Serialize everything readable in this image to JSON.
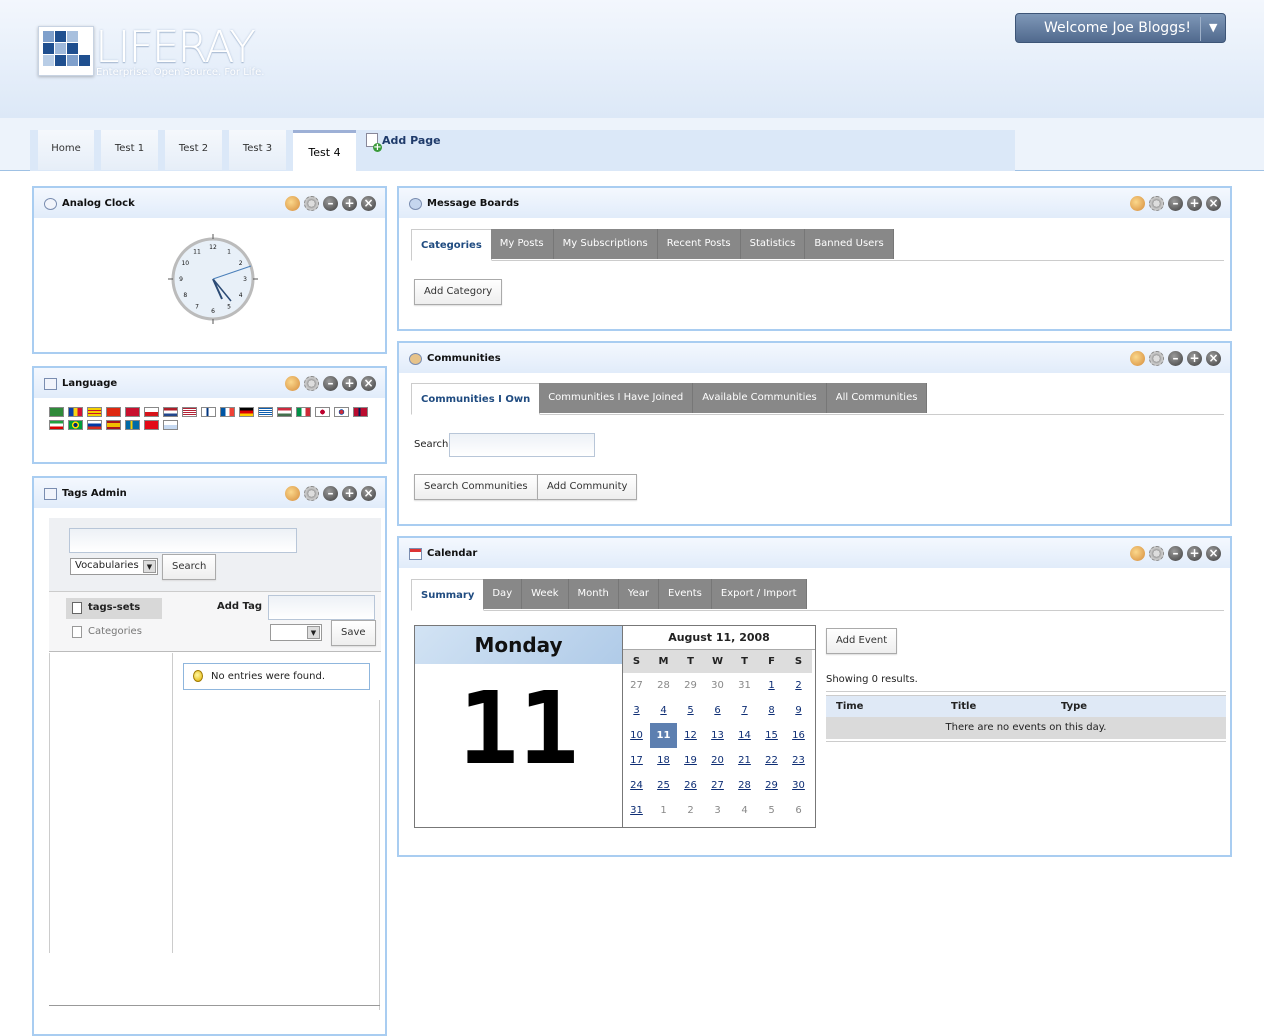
{
  "logo": {
    "word": "LIFERAY",
    "tagline": "Enterprise. Open Source. For Life."
  },
  "welcome": {
    "label": "Welcome Joe Bloggs!"
  },
  "nav": {
    "tabs": [
      "Home",
      "Test 1",
      "Test 2",
      "Test 3",
      "Test 4"
    ],
    "selected": "Test 4",
    "add_page": "Add Page"
  },
  "clock": {
    "title": "Analog Clock",
    "numbers": [
      "12",
      "1",
      "2",
      "3",
      "4",
      "5",
      "6",
      "7",
      "8",
      "9",
      "10",
      "11"
    ]
  },
  "language": {
    "title": "Language"
  },
  "tags": {
    "title": "Tags Admin",
    "select": "Vocabularies",
    "search_btn": "Search",
    "tree_selected": "tags-sets",
    "tree_other": "Categories",
    "add_tag_label": "Add Tag",
    "save_btn": "Save",
    "empty_msg": "No entries were found."
  },
  "message_boards": {
    "title": "Message Boards",
    "tabs": [
      "Categories",
      "My Posts",
      "My Subscriptions",
      "Recent Posts",
      "Statistics",
      "Banned Users"
    ],
    "add_btn": "Add Category"
  },
  "communities": {
    "title": "Communities",
    "tabs": [
      "Communities I Own",
      "Communities I Have Joined",
      "Available Communities",
      "All Communities"
    ],
    "search_label": "Search",
    "search_btn": "Search Communities",
    "add_btn": "Add Community"
  },
  "calendar": {
    "title": "Calendar",
    "tabs": [
      "Summary",
      "Day",
      "Week",
      "Month",
      "Year",
      "Events",
      "Export / Import"
    ],
    "weekday": "Monday",
    "day": "11",
    "month_title": "August 11, 2008",
    "dow": [
      "S",
      "M",
      "T",
      "W",
      "T",
      "F",
      "S"
    ],
    "cells": [
      "27",
      "28",
      "29",
      "30",
      "31",
      "1",
      "2",
      "3",
      "4",
      "5",
      "6",
      "7",
      "8",
      "9",
      "10",
      "11",
      "12",
      "13",
      "14",
      "15",
      "16",
      "17",
      "18",
      "19",
      "20",
      "21",
      "22",
      "23",
      "24",
      "25",
      "26",
      "27",
      "28",
      "29",
      "30",
      "31",
      "1",
      "2",
      "3",
      "4",
      "5",
      "6"
    ],
    "add_event": "Add Event",
    "showing": "Showing 0 results.",
    "cols": [
      "Time",
      "Title",
      "Type"
    ],
    "empty": "There are no events on this day."
  }
}
